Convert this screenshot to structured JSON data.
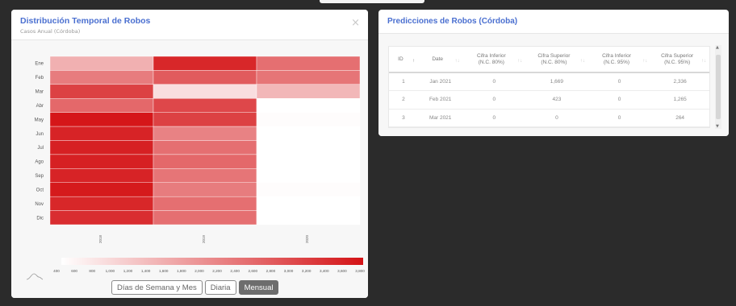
{
  "left_panel": {
    "title": "Distribución Temporal de Robos",
    "subtitle": "Casos Anual (Córdoba)",
    "close_label": "×",
    "buttons": [
      "Días de Semana y Mes",
      "Diaria",
      "Mensual"
    ],
    "active_button": "Mensual"
  },
  "right_panel": {
    "title": "Predicciones de Robos (Córdoba)",
    "columns": [
      "ID",
      "Date",
      "Cifra Inferior\n(N.C. 80%)",
      "Cifra Superior\n(N.C. 80%)",
      "Cifra Inferior\n(N.C. 95%)",
      "Cifra Superior\n(N.C. 95%)"
    ],
    "rows": [
      [
        "1",
        "Jan 2021",
        "0",
        "1,669",
        "0",
        "2,336"
      ],
      [
        "2",
        "Feb 2021",
        "0",
        "423",
        "0",
        "1,265"
      ],
      [
        "3",
        "Mar 2021",
        "0",
        "0",
        "0",
        "264"
      ]
    ]
  },
  "chart_data": {
    "type": "heatmap",
    "title": "Distribución Temporal de Robos",
    "subtitle": "Casos Anual (Córdoba)",
    "x_categories": [
      "2018",
      "2019",
      "2020"
    ],
    "y_categories": [
      "Ene",
      "Feb",
      "Mar",
      "Abr",
      "May",
      "Jun",
      "Jul",
      "Ago",
      "Sep",
      "Oct",
      "Nov",
      "Dic"
    ],
    "values": [
      [
        1600,
        3700,
        2600
      ],
      [
        2400,
        2900,
        2500
      ],
      [
        3300,
        900,
        1500
      ],
      [
        2700,
        3200,
        null
      ],
      [
        3950,
        3300,
        450
      ],
      [
        3750,
        2300,
        400
      ],
      [
        3800,
        2600,
        350
      ],
      [
        3800,
        2700,
        350
      ],
      [
        3750,
        2500,
        400
      ],
      [
        3900,
        2400,
        450
      ],
      [
        3700,
        2600,
        400
      ],
      [
        3600,
        2600,
        350
      ]
    ],
    "color_scale": {
      "min": 400,
      "max": 4000,
      "low_color": "#ffffff",
      "high_color": "#d41316"
    },
    "colorbar_ticks": [
      "400",
      "600",
      "800",
      "1,000",
      "1,200",
      "1,400",
      "1,600",
      "1,800",
      "2,000",
      "2,200",
      "2,400",
      "2,600",
      "2,800",
      "3,000",
      "3,200",
      "3,400",
      "3,600",
      "3,800"
    ],
    "grid": false
  }
}
